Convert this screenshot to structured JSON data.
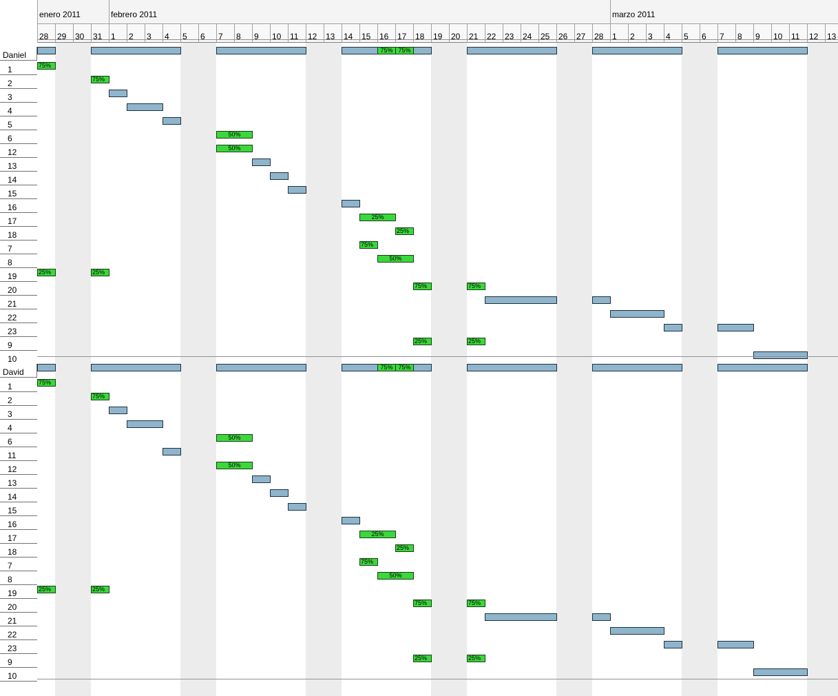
{
  "months": [
    {
      "label": "enero 2011",
      "first_day": 0,
      "days": 4
    },
    {
      "label": "febrero 2011",
      "first_day": 4,
      "days": 28
    },
    {
      "label": "marzo 2011",
      "first_day": 32,
      "days": 14
    }
  ],
  "days": [
    "28",
    "29",
    "30",
    "31",
    "1",
    "2",
    "3",
    "4",
    "5",
    "6",
    "7",
    "8",
    "9",
    "10",
    "11",
    "12",
    "13",
    "14",
    "15",
    "16",
    "17",
    "18",
    "19",
    "20",
    "21",
    "22",
    "23",
    "24",
    "25",
    "26",
    "27",
    "28",
    "1",
    "2",
    "3",
    "4",
    "5",
    "6",
    "7",
    "8",
    "9",
    "10",
    "11",
    "12",
    "13"
  ],
  "weekend_days": [
    1,
    2,
    8,
    9,
    15,
    16,
    22,
    23,
    29,
    30,
    36,
    37,
    43,
    44
  ],
  "groups": [
    {
      "name": "Daniel",
      "summary": [
        {
          "s": 0,
          "e": 1
        },
        {
          "s": 3,
          "e": 8
        },
        {
          "s": 10,
          "e": 15
        },
        {
          "s": 17,
          "e": 22,
          "labels": [
            {
              "d": 19,
              "t": "75%"
            },
            {
              "d": 20,
              "t": "75%"
            }
          ]
        },
        {
          "s": 24,
          "e": 29
        },
        {
          "s": 31,
          "e": 36
        },
        {
          "s": 38,
          "e": 43
        }
      ],
      "tasks": [
        {
          "label": "1",
          "bars": [
            {
              "s": 0,
              "e": 1,
              "pct": "75%"
            }
          ]
        },
        {
          "label": "2",
          "bars": [
            {
              "s": 3,
              "e": 4,
              "pct": "75%"
            }
          ]
        },
        {
          "label": "3",
          "bars": [
            {
              "s": 4,
              "e": 5
            }
          ]
        },
        {
          "label": "4",
          "bars": [
            {
              "s": 5,
              "e": 7
            }
          ]
        },
        {
          "label": "5",
          "bars": [
            {
              "s": 7,
              "e": 8
            }
          ]
        },
        {
          "label": "6",
          "bars": [
            {
              "s": 10,
              "e": 12,
              "pct": "50%"
            }
          ]
        },
        {
          "label": "12",
          "bars": [
            {
              "s": 10,
              "e": 12,
              "pct": "50%"
            }
          ]
        },
        {
          "label": "13",
          "bars": [
            {
              "s": 12,
              "e": 13
            }
          ]
        },
        {
          "label": "14",
          "bars": [
            {
              "s": 13,
              "e": 14
            }
          ]
        },
        {
          "label": "15",
          "bars": [
            {
              "s": 14,
              "e": 15
            }
          ]
        },
        {
          "label": "16",
          "bars": [
            {
              "s": 17,
              "e": 18
            }
          ]
        },
        {
          "label": "17",
          "bars": [
            {
              "s": 18,
              "e": 20,
              "pct": "25%"
            }
          ]
        },
        {
          "label": "18",
          "bars": [
            {
              "s": 20,
              "e": 21,
              "pct": "25%"
            }
          ]
        },
        {
          "label": "7",
          "bars": [
            {
              "s": 18,
              "e": 19,
              "pct": "75%"
            }
          ]
        },
        {
          "label": "8",
          "bars": [
            {
              "s": 19,
              "e": 21,
              "pct": "50%"
            }
          ]
        },
        {
          "label": "19",
          "bars": [
            {
              "s": 0,
              "e": 1,
              "pct": "25%"
            },
            {
              "s": 3,
              "e": 4,
              "pct": "25%"
            }
          ]
        },
        {
          "label": "20",
          "bars": [
            {
              "s": 21,
              "e": 22,
              "pct": "75%"
            },
            {
              "s": 24,
              "e": 25,
              "pct": "75%"
            }
          ]
        },
        {
          "label": "21",
          "bars": [
            {
              "s": 25,
              "e": 29
            },
            {
              "s": 31,
              "e": 32
            }
          ]
        },
        {
          "label": "22",
          "bars": [
            {
              "s": 32,
              "e": 35
            }
          ]
        },
        {
          "label": "23",
          "bars": [
            {
              "s": 35,
              "e": 36
            },
            {
              "s": 38,
              "e": 40
            }
          ]
        },
        {
          "label": "9",
          "bars": [
            {
              "s": 21,
              "e": 22,
              "pct": "25%"
            },
            {
              "s": 24,
              "e": 25,
              "pct": "25%"
            }
          ]
        },
        {
          "label": "10",
          "bars": [
            {
              "s": 40,
              "e": 43
            }
          ]
        }
      ]
    },
    {
      "name": "David",
      "summary": [
        {
          "s": 0,
          "e": 1
        },
        {
          "s": 3,
          "e": 8
        },
        {
          "s": 10,
          "e": 15
        },
        {
          "s": 17,
          "e": 22,
          "labels": [
            {
              "d": 19,
              "t": "75%"
            },
            {
              "d": 20,
              "t": "75%"
            }
          ]
        },
        {
          "s": 24,
          "e": 29
        },
        {
          "s": 31,
          "e": 36
        },
        {
          "s": 38,
          "e": 43
        }
      ],
      "tasks": [
        {
          "label": "1",
          "bars": [
            {
              "s": 0,
              "e": 1,
              "pct": "75%"
            }
          ]
        },
        {
          "label": "2",
          "bars": [
            {
              "s": 3,
              "e": 4,
              "pct": "75%"
            }
          ]
        },
        {
          "label": "3",
          "bars": [
            {
              "s": 4,
              "e": 5
            }
          ]
        },
        {
          "label": "4",
          "bars": [
            {
              "s": 5,
              "e": 7
            }
          ]
        },
        {
          "label": "6",
          "bars": [
            {
              "s": 10,
              "e": 12,
              "pct": "50%"
            }
          ]
        },
        {
          "label": "11",
          "bars": [
            {
              "s": 7,
              "e": 8
            }
          ]
        },
        {
          "label": "12",
          "bars": [
            {
              "s": 10,
              "e": 12,
              "pct": "50%"
            }
          ]
        },
        {
          "label": "13",
          "bars": [
            {
              "s": 12,
              "e": 13
            }
          ]
        },
        {
          "label": "14",
          "bars": [
            {
              "s": 13,
              "e": 14
            }
          ]
        },
        {
          "label": "15",
          "bars": [
            {
              "s": 14,
              "e": 15
            }
          ]
        },
        {
          "label": "16",
          "bars": [
            {
              "s": 17,
              "e": 18
            }
          ]
        },
        {
          "label": "17",
          "bars": [
            {
              "s": 18,
              "e": 20,
              "pct": "25%"
            }
          ]
        },
        {
          "label": "18",
          "bars": [
            {
              "s": 20,
              "e": 21,
              "pct": "25%"
            }
          ]
        },
        {
          "label": "7",
          "bars": [
            {
              "s": 18,
              "e": 19,
              "pct": "75%"
            }
          ]
        },
        {
          "label": "8",
          "bars": [
            {
              "s": 19,
              "e": 21,
              "pct": "50%"
            }
          ]
        },
        {
          "label": "19",
          "bars": [
            {
              "s": 0,
              "e": 1,
              "pct": "25%"
            },
            {
              "s": 3,
              "e": 4,
              "pct": "25%"
            }
          ]
        },
        {
          "label": "20",
          "bars": [
            {
              "s": 21,
              "e": 22,
              "pct": "75%"
            },
            {
              "s": 24,
              "e": 25,
              "pct": "75%"
            }
          ]
        },
        {
          "label": "21",
          "bars": [
            {
              "s": 25,
              "e": 29
            },
            {
              "s": 31,
              "e": 32
            }
          ]
        },
        {
          "label": "22",
          "bars": [
            {
              "s": 32,
              "e": 35
            }
          ]
        },
        {
          "label": "23",
          "bars": [
            {
              "s": 35,
              "e": 36
            },
            {
              "s": 38,
              "e": 40
            }
          ]
        },
        {
          "label": "9",
          "bars": [
            {
              "s": 21,
              "e": 22,
              "pct": "25%"
            },
            {
              "s": 24,
              "e": 25,
              "pct": "25%"
            }
          ]
        },
        {
          "label": "10",
          "bars": [
            {
              "s": 40,
              "e": 43
            }
          ]
        }
      ]
    }
  ],
  "colors": {
    "task_bar": "#8fb5cd",
    "progress_bar": "#3bd83b",
    "weekend": "#ececec"
  }
}
